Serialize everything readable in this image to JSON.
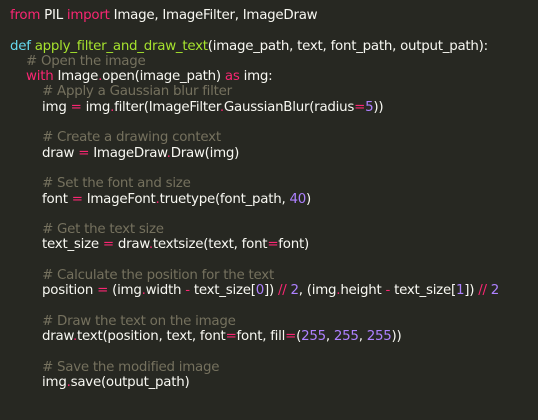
{
  "editor": {
    "colors": {
      "background": "#272822",
      "text": "#f8f8f2",
      "keyword": "#f92672",
      "storage": "#66d9ef",
      "function": "#a6e22e",
      "number": "#ae81ff",
      "comment": "#75715e"
    },
    "lines": [
      [
        [
          "kw",
          "from"
        ],
        [
          "txt",
          " PIL "
        ],
        [
          "kw",
          "import"
        ],
        [
          "txt",
          " Image, ImageFilter, ImageDraw"
        ]
      ],
      [],
      [
        [
          "def",
          "def"
        ],
        [
          "txt",
          " "
        ],
        [
          "fn",
          "apply_filter_and_draw_text"
        ],
        [
          "txt",
          "(image_path, text, font_path, output_path):"
        ]
      ],
      [
        [
          "txt",
          "    "
        ],
        [
          "cm",
          "# Open the image"
        ]
      ],
      [
        [
          "txt",
          "    "
        ],
        [
          "kw",
          "with"
        ],
        [
          "txt",
          " Image"
        ],
        [
          "op",
          "."
        ],
        [
          "txt",
          "open(image_path) "
        ],
        [
          "kw",
          "as"
        ],
        [
          "txt",
          " img:"
        ]
      ],
      [
        [
          "txt",
          "        "
        ],
        [
          "cm",
          "# Apply a Gaussian blur filter"
        ]
      ],
      [
        [
          "txt",
          "        img "
        ],
        [
          "op",
          "="
        ],
        [
          "txt",
          " img"
        ],
        [
          "op",
          "."
        ],
        [
          "txt",
          "filter(ImageFilter"
        ],
        [
          "op",
          "."
        ],
        [
          "txt",
          "GaussianBlur(radius"
        ],
        [
          "op",
          "="
        ],
        [
          "num",
          "5"
        ],
        [
          "txt",
          "))"
        ]
      ],
      [],
      [
        [
          "txt",
          "        "
        ],
        [
          "cm",
          "# Create a drawing context"
        ]
      ],
      [
        [
          "txt",
          "        draw "
        ],
        [
          "op",
          "="
        ],
        [
          "txt",
          " ImageDraw"
        ],
        [
          "op",
          "."
        ],
        [
          "txt",
          "Draw(img)"
        ]
      ],
      [],
      [
        [
          "txt",
          "        "
        ],
        [
          "cm",
          "# Set the font and size"
        ]
      ],
      [
        [
          "txt",
          "        font "
        ],
        [
          "op",
          "="
        ],
        [
          "txt",
          " ImageFont"
        ],
        [
          "op",
          "."
        ],
        [
          "txt",
          "truetype(font_path, "
        ],
        [
          "num",
          "40"
        ],
        [
          "txt",
          ")"
        ]
      ],
      [],
      [
        [
          "txt",
          "        "
        ],
        [
          "cm",
          "# Get the text size"
        ]
      ],
      [
        [
          "txt",
          "        text_size "
        ],
        [
          "op",
          "="
        ],
        [
          "txt",
          " draw"
        ],
        [
          "op",
          "."
        ],
        [
          "txt",
          "textsize(text, font"
        ],
        [
          "op",
          "="
        ],
        [
          "txt",
          "font)"
        ]
      ],
      [],
      [
        [
          "txt",
          "        "
        ],
        [
          "cm",
          "# Calculate the position for the text"
        ]
      ],
      [
        [
          "txt",
          "        position "
        ],
        [
          "op",
          "="
        ],
        [
          "txt",
          " (img"
        ],
        [
          "op",
          "."
        ],
        [
          "txt",
          "width "
        ],
        [
          "op",
          "-"
        ],
        [
          "txt",
          " text_size["
        ],
        [
          "num",
          "0"
        ],
        [
          "txt",
          "]) "
        ],
        [
          "op",
          "//"
        ],
        [
          "txt",
          " "
        ],
        [
          "num",
          "2"
        ],
        [
          "txt",
          ", (img"
        ],
        [
          "op",
          "."
        ],
        [
          "txt",
          "height "
        ],
        [
          "op",
          "-"
        ],
        [
          "txt",
          " text_size["
        ],
        [
          "num",
          "1"
        ],
        [
          "txt",
          "]) "
        ],
        [
          "op",
          "//"
        ],
        [
          "txt",
          " "
        ],
        [
          "num",
          "2"
        ]
      ],
      [],
      [
        [
          "txt",
          "        "
        ],
        [
          "cm",
          "# Draw the text on the image"
        ]
      ],
      [
        [
          "txt",
          "        draw"
        ],
        [
          "op",
          "."
        ],
        [
          "txt",
          "text(position, text, font"
        ],
        [
          "op",
          "="
        ],
        [
          "txt",
          "font, fill"
        ],
        [
          "op",
          "="
        ],
        [
          "txt",
          "("
        ],
        [
          "num",
          "255"
        ],
        [
          "txt",
          ", "
        ],
        [
          "num",
          "255"
        ],
        [
          "txt",
          ", "
        ],
        [
          "num",
          "255"
        ],
        [
          "txt",
          "))"
        ]
      ],
      [],
      [
        [
          "txt",
          "        "
        ],
        [
          "cm",
          "# Save the modified image"
        ]
      ],
      [
        [
          "txt",
          "        img"
        ],
        [
          "op",
          "."
        ],
        [
          "txt",
          "save(output_path)"
        ]
      ]
    ]
  }
}
